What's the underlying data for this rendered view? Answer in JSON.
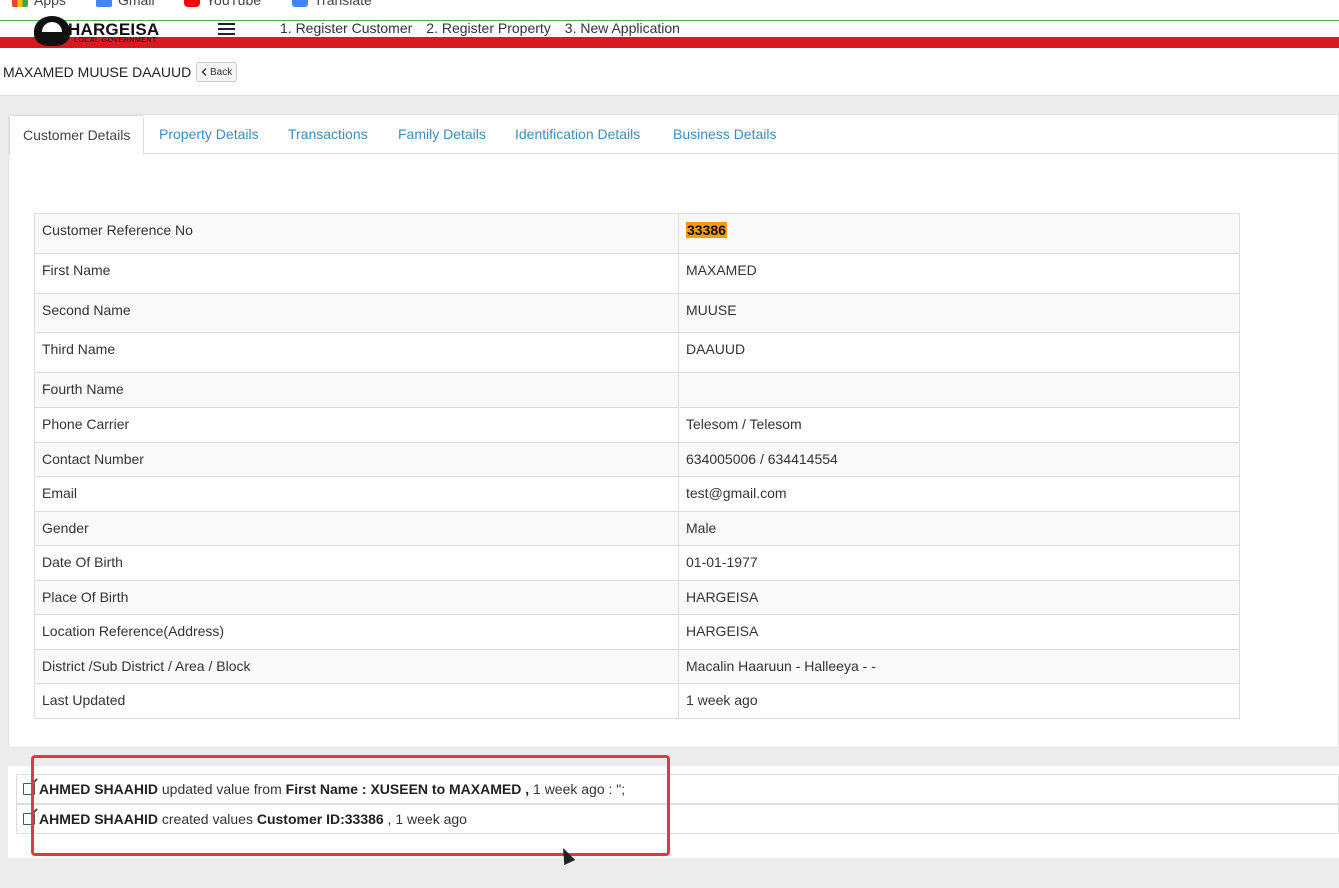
{
  "browser": {
    "bookmarks": [
      "Apps",
      "Gmail",
      "YouTube",
      "Translate"
    ]
  },
  "header": {
    "logo_text": "HARGEISA",
    "logo_sub": "LOCAL GOVERNMENT",
    "nav": [
      "1. Register Customer",
      "2. Register Property",
      "3. New Application"
    ]
  },
  "page": {
    "title": "MAXAMED MUUSE DAAUUD",
    "back_label": "Back"
  },
  "tabs": [
    {
      "label": "Customer Details",
      "active": true
    },
    {
      "label": "Property Details"
    },
    {
      "label": "Transactions"
    },
    {
      "label": "Family Details"
    },
    {
      "label": "Identification Details"
    },
    {
      "label": "Business Details"
    }
  ],
  "details": [
    {
      "label": "Customer Reference No",
      "value": "33386",
      "highlight": true
    },
    {
      "label": "First Name",
      "value": "MAXAMED"
    },
    {
      "label": "Second Name",
      "value": "MUUSE"
    },
    {
      "label": "Third Name",
      "value": "DAAUUD"
    },
    {
      "label": "Fourth Name",
      "value": ""
    },
    {
      "label": "Phone Carrier",
      "value": "Telesom / Telesom"
    },
    {
      "label": "Contact Number",
      "value": "634005006 / 634414554"
    },
    {
      "label": "Email",
      "value": "test@gmail.com"
    },
    {
      "label": "Gender",
      "value": "Male"
    },
    {
      "label": "Date Of Birth",
      "value": "01-01-1977"
    },
    {
      "label": "Place Of Birth",
      "value": "HARGEISA"
    },
    {
      "label": "Location Reference(Address)",
      "value": "HARGEISA"
    },
    {
      "label": "District /Sub District / Area / Block",
      "value": "Macalin Haaruun - Halleeya - -"
    },
    {
      "label": "Last Updated",
      "value": "1 week ago"
    }
  ],
  "logs": [
    {
      "user": "AHMED SHAAHID",
      "action": " updated value from ",
      "subject": "First Name : XUSEEN to MAXAMED ,",
      "suffix": " 1 week ago : \";"
    },
    {
      "user": "AHMED SHAAHID",
      "action": " created values ",
      "subject": "Customer ID:33386",
      "suffix": " , 1 week ago"
    }
  ],
  "colors": {
    "accent_link": "#3c8dbc",
    "header_red": "#d71920",
    "highlight": "#f39c12",
    "annotation_box": "#e03a3a"
  }
}
